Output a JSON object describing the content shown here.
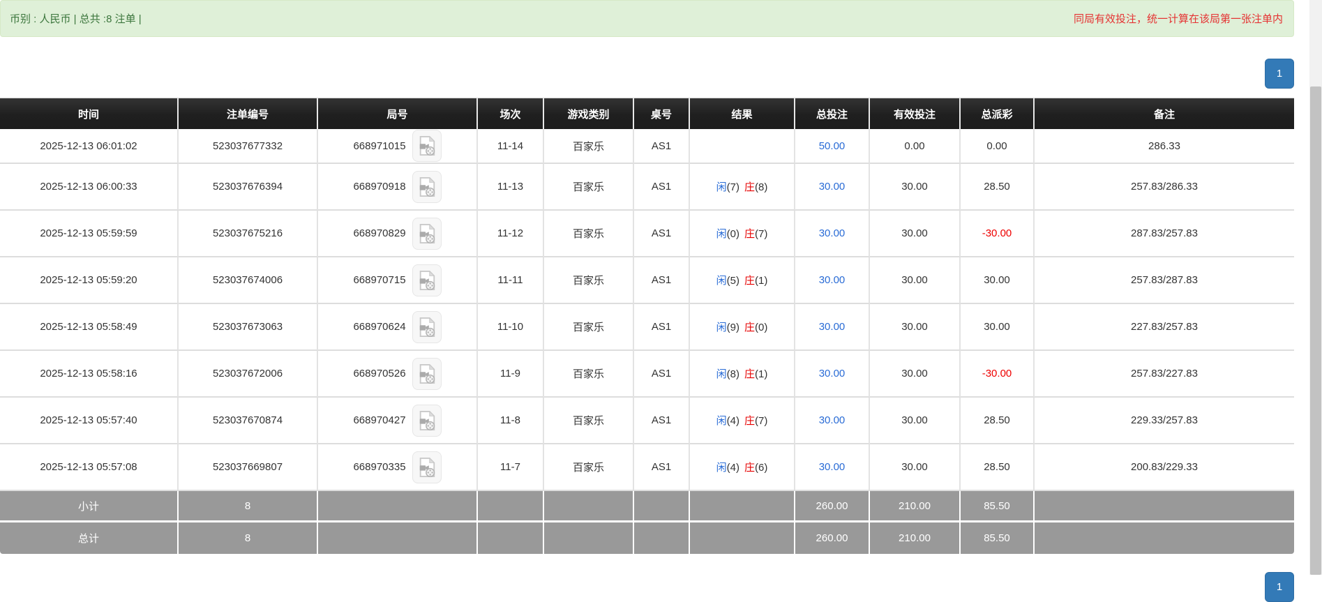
{
  "notice_bar": {
    "left": "币别 : 人民币 | 总共 :8 注单 |",
    "right": "同局有效投注，统一计算在该局第一张注单内"
  },
  "pagination": {
    "page": "1"
  },
  "table": {
    "headers": [
      "时间",
      "注单编号",
      "局号",
      "场次",
      "游戏类别",
      "桌号",
      "结果",
      "总投注",
      "有效投注",
      "总派彩",
      "备注"
    ],
    "video_icon": "video-file-icon",
    "rows": [
      {
        "time": "2025-12-13 06:01:02",
        "bet_id": "523037677332",
        "round": "668971015",
        "video": false,
        "session": "11-14",
        "game": "百家乐",
        "table_no": "AS1",
        "result": null,
        "total_bet": "50.00",
        "valid_bet": "0.00",
        "payout": "0.00",
        "remark": "286.33"
      },
      {
        "time": "2025-12-13 06:00:33",
        "bet_id": "523037676394",
        "round": "668970918",
        "video": true,
        "session": "11-13",
        "game": "百家乐",
        "table_no": "AS1",
        "result": {
          "player": "闲",
          "player_pts": "(7)",
          "banker": "庄",
          "banker_pts": "(8)"
        },
        "total_bet": "30.00",
        "valid_bet": "30.00",
        "payout": "28.50",
        "remark": "257.83/286.33"
      },
      {
        "time": "2025-12-13 05:59:59",
        "bet_id": "523037675216",
        "round": "668970829",
        "video": true,
        "session": "11-12",
        "game": "百家乐",
        "table_no": "AS1",
        "result": {
          "player": "闲",
          "player_pts": "(0)",
          "banker": "庄",
          "banker_pts": "(7)"
        },
        "total_bet": "30.00",
        "valid_bet": "30.00",
        "payout": "-30.00",
        "remark": "287.83/257.83"
      },
      {
        "time": "2025-12-13 05:59:20",
        "bet_id": "523037674006",
        "round": "668970715",
        "video": true,
        "session": "11-11",
        "game": "百家乐",
        "table_no": "AS1",
        "result": {
          "player": "闲",
          "player_pts": "(5)",
          "banker": "庄",
          "banker_pts": "(1)"
        },
        "total_bet": "30.00",
        "valid_bet": "30.00",
        "payout": "30.00",
        "remark": "257.83/287.83"
      },
      {
        "time": "2025-12-13 05:58:49",
        "bet_id": "523037673063",
        "round": "668970624",
        "video": true,
        "session": "11-10",
        "game": "百家乐",
        "table_no": "AS1",
        "result": {
          "player": "闲",
          "player_pts": "(9)",
          "banker": "庄",
          "banker_pts": "(0)"
        },
        "total_bet": "30.00",
        "valid_bet": "30.00",
        "payout": "30.00",
        "remark": "227.83/257.83"
      },
      {
        "time": "2025-12-13 05:58:16",
        "bet_id": "523037672006",
        "round": "668970526",
        "video": true,
        "session": "11-9",
        "game": "百家乐",
        "table_no": "AS1",
        "result": {
          "player": "闲",
          "player_pts": "(8)",
          "banker": "庄",
          "banker_pts": "(1)"
        },
        "total_bet": "30.00",
        "valid_bet": "30.00",
        "payout": "-30.00",
        "remark": "257.83/227.83"
      },
      {
        "time": "2025-12-13 05:57:40",
        "bet_id": "523037670874",
        "round": "668970427",
        "video": true,
        "session": "11-8",
        "game": "百家乐",
        "table_no": "AS1",
        "result": {
          "player": "闲",
          "player_pts": "(4)",
          "banker": "庄",
          "banker_pts": "(7)"
        },
        "total_bet": "30.00",
        "valid_bet": "30.00",
        "payout": "28.50",
        "remark": "229.33/257.83"
      },
      {
        "time": "2025-12-13 05:57:08",
        "bet_id": "523037669807",
        "round": "668970335",
        "video": true,
        "session": "11-7",
        "game": "百家乐",
        "table_no": "AS1",
        "result": {
          "player": "闲",
          "player_pts": "(4)",
          "banker": "庄",
          "banker_pts": "(6)"
        },
        "total_bet": "30.00",
        "valid_bet": "30.00",
        "payout": "28.50",
        "remark": "200.83/229.33"
      }
    ],
    "subtotal": {
      "label": "小计",
      "count": "8",
      "total_bet": "260.00",
      "valid_bet": "210.00",
      "payout": "85.50"
    },
    "total": {
      "label": "总计",
      "count": "8",
      "total_bet": "260.00",
      "valid_bet": "210.00",
      "payout": "85.50"
    }
  },
  "colors": {
    "link_blue": "#2a6cd6",
    "player_blue": "#2a6cd6",
    "banker_red": "#e60000",
    "loss_red": "#ee0000",
    "notice_red": "#e53333",
    "success_bg": "#dff0d8",
    "success_text": "#3c763d",
    "pagination_blue": "#337ab7",
    "header_bg": "#1d1d1d",
    "summary_gray": "#999999"
  }
}
